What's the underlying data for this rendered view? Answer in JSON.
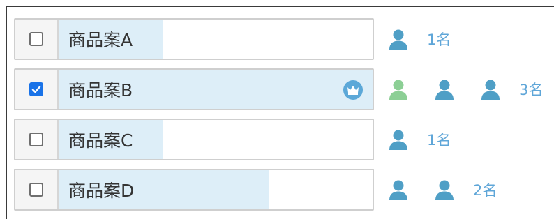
{
  "options": [
    {
      "label": "商品案A",
      "checked": false,
      "vote_fraction": 0.33,
      "is_top": false,
      "voters": [
        "voter-icon-blue"
      ],
      "count_text": "1名"
    },
    {
      "label": "商品案B",
      "checked": true,
      "vote_fraction": 1.0,
      "is_top": true,
      "voters": [
        "voter-icon-green",
        "voter-icon-blue",
        "voter-icon-blue"
      ],
      "count_text": "3名"
    },
    {
      "label": "商品案C",
      "checked": false,
      "vote_fraction": 0.33,
      "is_top": false,
      "voters": [
        "voter-icon-blue"
      ],
      "count_text": "1名"
    },
    {
      "label": "商品案D",
      "checked": false,
      "vote_fraction": 0.67,
      "is_top": false,
      "voters": [
        "voter-icon-blue",
        "voter-icon-blue"
      ],
      "count_text": "2名"
    }
  ],
  "colors": {
    "fill": "#ddeef8",
    "voter_blue": "#4f9fc6",
    "voter_green": "#8ccf95",
    "count_text": "#5fa6d8",
    "checkbox_checked": "#1a73e8",
    "crown_badge": "#5ca8d8"
  }
}
